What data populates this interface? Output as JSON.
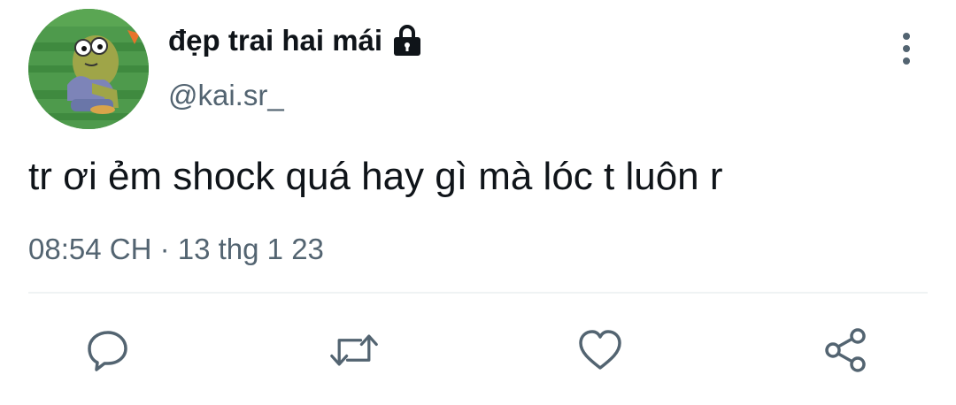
{
  "user": {
    "display_name": "đẹp trai hai mái",
    "handle": "@kai.sr_",
    "avatar_icon": "avatar-image",
    "protected_icon": "lock-icon"
  },
  "tweet": {
    "text": "tr ơi ẻm shock quá hay gì mà lóc t luôn r",
    "time": "08:54 CH",
    "separator": "·",
    "date": "13 thg 1 23"
  },
  "actions": [
    {
      "icon": "reply-icon"
    },
    {
      "icon": "retweet-icon"
    },
    {
      "icon": "like-icon"
    },
    {
      "icon": "share-icon"
    }
  ],
  "colors": {
    "text_primary": "#0f1419",
    "text_secondary": "#536471",
    "icon": "#536471",
    "divider": "#eff3f4"
  }
}
